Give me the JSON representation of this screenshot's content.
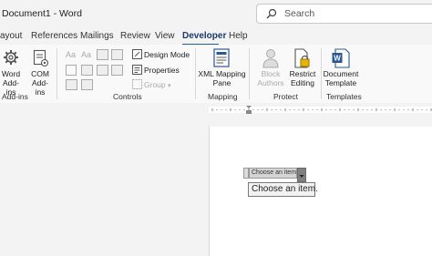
{
  "title": {
    "text": "Document1 - Word"
  },
  "search": {
    "placeholder": "Search"
  },
  "tabs": [
    {
      "label": "ayout"
    },
    {
      "label": "References"
    },
    {
      "label": "Mailings"
    },
    {
      "label": "Review"
    },
    {
      "label": "View"
    },
    {
      "label": "Developer",
      "active": true
    },
    {
      "label": "Help"
    }
  ],
  "ribbon": {
    "addins": {
      "label": "Add-ins",
      "word_addins": "Word\nAdd-ins",
      "com_addins": "COM\nAdd-ins"
    },
    "controls": {
      "label": "Controls",
      "design_mode": "Design Mode",
      "properties": "Properties",
      "group": "Group"
    },
    "mapping": {
      "label": "Mapping",
      "xml_mapping": "XML Mapping\nPane"
    },
    "protect": {
      "label": "Protect",
      "block_authors": "Block\nAuthors",
      "restrict_editing": "Restrict\nEditing"
    },
    "templates": {
      "label": "Templates",
      "document_template": "Document\nTemplate"
    }
  },
  "content_control": {
    "placeholder": "Choose an item.",
    "dropdown_option": "Choose an item."
  },
  "colors": {
    "accent": "#1b5fb5",
    "word_blue": "#2b579a"
  }
}
